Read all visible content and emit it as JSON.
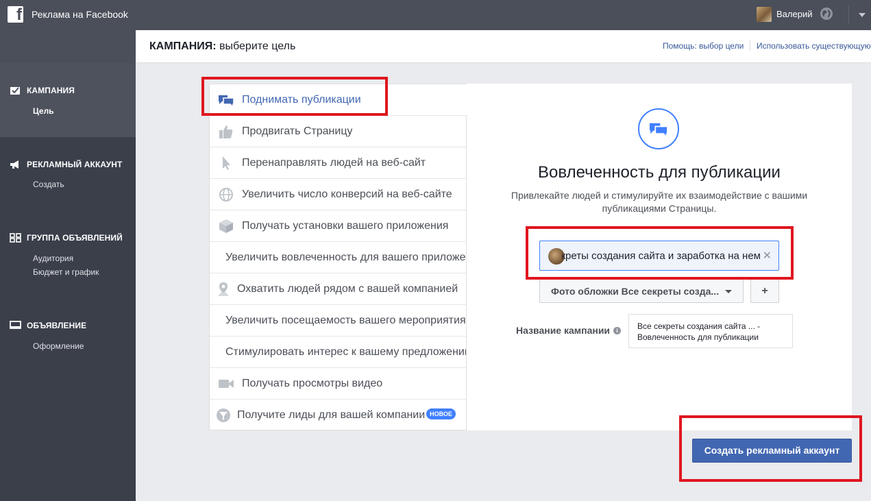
{
  "topbar": {
    "app_title": "Реклама на Facebook",
    "user_name": "Валерий",
    "logo_letter": "f"
  },
  "sidebar": {
    "groups": [
      {
        "icon": "campaign-check-icon",
        "title": "КАМПАНИЯ",
        "items": [
          "Цель"
        ],
        "active": true
      },
      {
        "icon": "megaphone-icon",
        "title": "РЕКЛАМНЫЙ АККАУНТ",
        "items": [
          "Создать"
        ]
      },
      {
        "icon": "grid-icon",
        "title": "ГРУППА ОБЪЯВЛЕНИЙ",
        "items": [
          "Аудитория",
          "Бюджет и график"
        ]
      },
      {
        "icon": "monitor-icon",
        "title": "ОБЪЯВЛЕНИЕ",
        "items": [
          "Оформление"
        ]
      }
    ]
  },
  "header": {
    "title_bold": "КАМПАНИЯ:",
    "title_rest": " выберите цель",
    "help_link": "Помощь: выбор цели",
    "use_existing_link": "Использовать существующую"
  },
  "objectives": [
    {
      "label": "Поднимать публикации",
      "icon": "speech-bubbles-icon",
      "selected": true
    },
    {
      "label": "Продвигать Страницу",
      "icon": "thumbs-up-icon"
    },
    {
      "label": "Перенаправлять людей на веб-сайт",
      "icon": "cursor-icon"
    },
    {
      "label": "Увеличить число конверсий на веб-сайте",
      "icon": "globe-icon"
    },
    {
      "label": "Получать установки вашего приложения",
      "icon": "box-icon"
    },
    {
      "label": "Увеличить вовлеченность для вашего приложения",
      "icon": ""
    },
    {
      "label": "Охватить людей рядом с вашей компанией",
      "icon": "map-pin-icon"
    },
    {
      "label": "Увеличить посещаемость вашего мероприятия",
      "icon": ""
    },
    {
      "label": "Стимулировать интерес к вашему предложению",
      "icon": ""
    },
    {
      "label": "Получать просмотры видео",
      "icon": "video-camera-icon"
    },
    {
      "label": "Получите лиды для вашей компании",
      "icon": "funnel-icon",
      "badge": "НОВОЕ"
    }
  ],
  "detail": {
    "title": "Вовлеченность для публикации",
    "description": "Привлекайте людей и стимулируйте их взаимодействие с вашими публикациями Страницы.",
    "page_value": "Все секреты создания сайта и заработка на нем",
    "cover_select": "Фото обложки Все секреты созда...",
    "add_label": "+",
    "campaign_name_label": "Название кампании",
    "campaign_name_value": "Все секреты создания сайта ... - Вовлеченность для публикации"
  },
  "create_button": "Создать рекламный аккаунт",
  "colors": {
    "topbar": "#4a4f5a",
    "sidebar": "#3a3f4a",
    "accent": "#4267b2",
    "highlight": "#e0161f"
  }
}
